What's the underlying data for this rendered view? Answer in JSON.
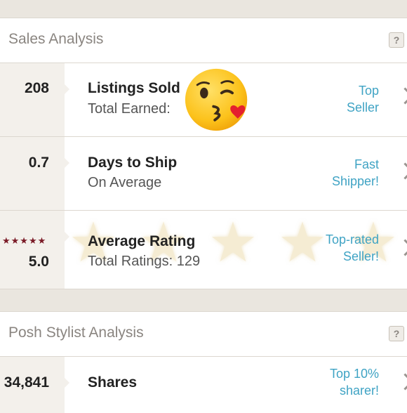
{
  "sales": {
    "title": "Sales Analysis",
    "help": "?",
    "rows": [
      {
        "value": "208",
        "label": "Listings Sold",
        "sub": "Total Earned:",
        "badge_line1": "Top",
        "badge_line2": "Seller"
      },
      {
        "value": "0.7",
        "label": "Days to Ship",
        "sub": "On Average",
        "badge_line1": "Fast",
        "badge_line2": "Shipper!"
      },
      {
        "value": "5.0",
        "stars": "★★★★★",
        "label": "Average Rating",
        "sub": "Total Ratings: 129",
        "badge_line1": "Top-rated",
        "badge_line2": "Seller!"
      }
    ]
  },
  "stylist": {
    "title": "Posh Stylist Analysis",
    "help": "?",
    "rows": [
      {
        "value": "34,841",
        "label": "Shares",
        "badge_line1": "Top 10%",
        "badge_line2": "sharer!"
      }
    ]
  },
  "icons": {
    "emoji": "kissing-face-emoji",
    "chevron": "chevron-right-icon",
    "star": "star-icon"
  },
  "colors": {
    "badge": "#3fa3c4",
    "stars": "#7a1a26",
    "background": "#efece7"
  }
}
